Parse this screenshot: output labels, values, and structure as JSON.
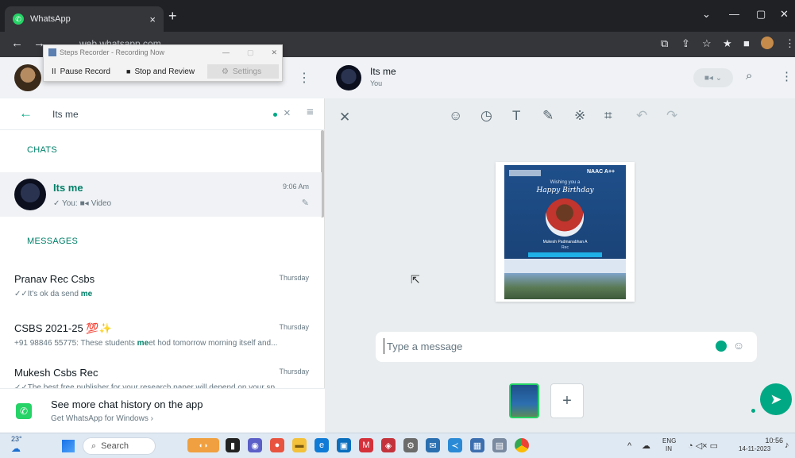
{
  "browser": {
    "tab_title": "WhatsApp",
    "tab_close": "×",
    "new_tab": "+",
    "address": "web.whatsapp.com"
  },
  "recorder": {
    "title": "Steps Recorder - Recording Now",
    "pause": "Pause Record",
    "stop": "Stop and Review",
    "settings": "Settings"
  },
  "search": {
    "value": "Its me",
    "clear": "×"
  },
  "sections": {
    "chats": "CHATS",
    "messages": "MESSAGES"
  },
  "chat": {
    "name": "Its me",
    "time": "9:06 Am",
    "preview_prefix": "✓ You:",
    "preview_media": "Video"
  },
  "messages": [
    {
      "name": "Pranav Rec Csbs",
      "time": "Thursday",
      "pre": "✓✓It's ok da send ",
      "hl": "me",
      "post": ""
    },
    {
      "name": "CSBS 2021-25 💯✨",
      "time": "Thursday",
      "pre": "+91 98846 55775: These students ",
      "hl": "me",
      "post": "et hod tomorrow morning itself and..."
    },
    {
      "name": "Mukesh Csbs Rec",
      "time": "Thursday",
      "pre": "✓✓The best free publisher for your research paper will depend on your sp...",
      "hl": "",
      "post": ""
    }
  ],
  "promo": {
    "title": "See more chat history on the app",
    "subtitle": "Get WhatsApp for Windows ›"
  },
  "contact": {
    "name": "Its me",
    "status": "You"
  },
  "poster": {
    "brand": "NAAC A++",
    "greeting": "Wishing you a",
    "script": "Happy Birthday",
    "person": "Mukesh Padmanabhan A",
    "dept": "Rec"
  },
  "composer": {
    "placeholder": "Type a message"
  },
  "taskbar": {
    "temp": "23°",
    "search": "Search",
    "lang": "ENG",
    "region": "IN",
    "time": "10:56",
    "date": "14-11-2023"
  },
  "colors": {
    "accent": "#00a884",
    "highlight": "#008069",
    "chrome": "#202124"
  }
}
